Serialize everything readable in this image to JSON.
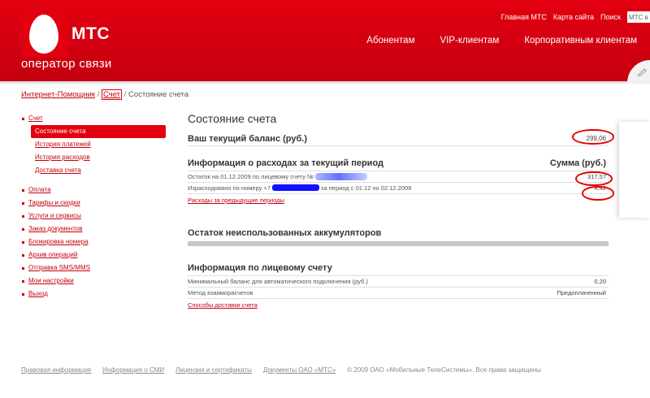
{
  "header": {
    "logo_text": "МТС",
    "tagline": "оператор связи",
    "top_links": [
      "Главная МТС",
      "Карта сайта",
      "Поиск"
    ],
    "search_value": "МТС в",
    "nav": [
      "Абонентам",
      "VIP-клиентам",
      "Корпоративным клиентам"
    ]
  },
  "breadcrumb": {
    "home": "Интернет-Помощник",
    "sep": "/",
    "account": "Счет",
    "current": "Состояние счета"
  },
  "sidebar": {
    "items": [
      {
        "label": "Счет",
        "sub": [
          "Состояние счета",
          "История платежей",
          "История расходов",
          "Доставка счета"
        ]
      },
      {
        "label": "Оплата"
      },
      {
        "label": "Тарифы и скидки"
      },
      {
        "label": "Услуги и сервисы"
      },
      {
        "label": "Заказ документов"
      },
      {
        "label": "Блокировка номера"
      },
      {
        "label": "Архив операций"
      },
      {
        "label": "Отправка SMS/MMS"
      },
      {
        "label": "Мои настройки"
      },
      {
        "label": "Выход"
      }
    ]
  },
  "main": {
    "title": "Состояние счета",
    "balance": {
      "label": "Ваш текущий баланс (руб.)",
      "value": "299,06"
    },
    "expenses": {
      "heading": "Информация о расходах за текущий период",
      "sum_heading": "Сумма (руб.)",
      "rows": [
        {
          "label_start": "Остаток на 01.12.2009 по лицевому счету №",
          "label_end": "",
          "value": "317,57"
        },
        {
          "label_start": "Израсходовано по номеру +7",
          "label_end": "за период с 01.12 по 02.12.2009",
          "value": "4,42"
        }
      ],
      "link": "Расходы за предыдущие периоды"
    },
    "accumulators": {
      "heading": "Остаток неиспользованных аккумуляторов"
    },
    "account_info": {
      "heading": "Информация по лицевому счету",
      "rows": [
        {
          "label": "Минимальный баланс для автоматического подключения (руб.)",
          "value": "0,20"
        },
        {
          "label": "Метод взаиморасчетов",
          "value": "Предоплаченный"
        }
      ],
      "link": "Способы доставки счета"
    }
  },
  "footer": {
    "links": [
      "Правовая информация",
      "Информация о СМИ",
      "Лицензия и сертификаты",
      "Документы ОАО «МТС»"
    ],
    "copyright": "© 2009 ОАО «Мобильные ТелеСистемы». Все права защищены"
  },
  "colors": {
    "brand_red": "#e2000f",
    "link_red": "#c4000e",
    "annotation_red": "#e60000",
    "redaction_blue": "#1010ff"
  }
}
